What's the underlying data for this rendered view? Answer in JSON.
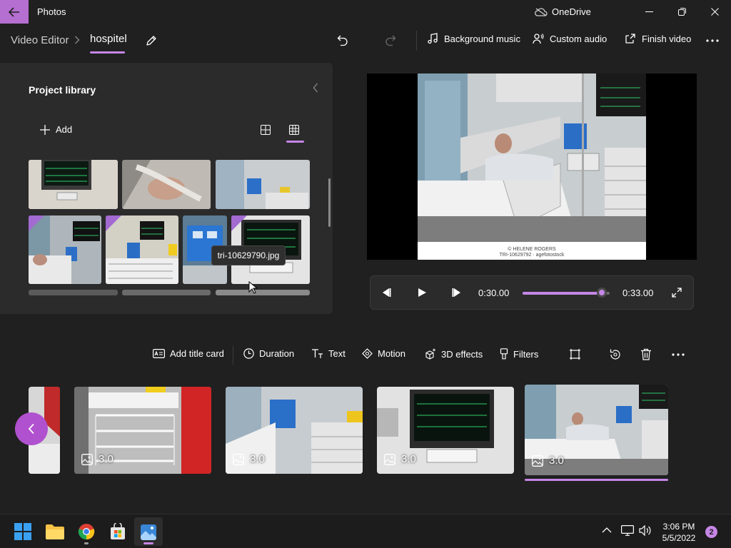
{
  "app": {
    "title": "Photos",
    "onedrive_label": "OneDrive"
  },
  "breadcrumb": {
    "root": "Video Editor",
    "project": "hospitel"
  },
  "commands": {
    "background_music": "Background music",
    "custom_audio": "Custom audio",
    "finish_video": "Finish video"
  },
  "library": {
    "title": "Project library",
    "add_label": "Add",
    "tooltip": "tri-10629790.jpg"
  },
  "player": {
    "current_time": "0:30.00",
    "total_time": "0:33.00",
    "progress": 0.909
  },
  "preview": {
    "watermark_line1": "© HELENE ROGERS",
    "watermark_line2": "TRI-10629792 · agefotostock"
  },
  "storyboard": {
    "toolbar": {
      "add_title_card": "Add title card",
      "duration": "Duration",
      "text": "Text",
      "motion": "Motion",
      "effects_3d": "3D effects",
      "filters": "Filters"
    },
    "clips": [
      {
        "duration": "3.0"
      },
      {
        "duration": "3.0"
      },
      {
        "duration": "3.0"
      },
      {
        "duration": "3.0"
      }
    ]
  },
  "taskbar": {
    "time": "3:06 PM",
    "date": "5/5/2022",
    "notifications": "2"
  },
  "colors": {
    "accent": "#c586e6",
    "accent_dark": "#b051cf",
    "background": "#202020",
    "panel": "#2b2b2b"
  }
}
